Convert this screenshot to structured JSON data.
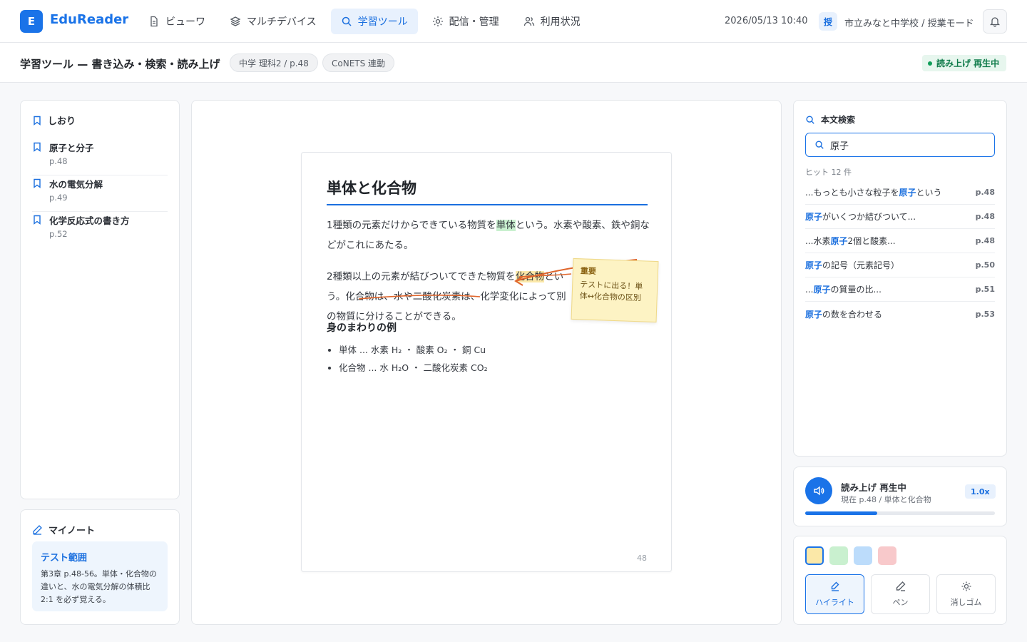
{
  "app": {
    "logo_letter": "E",
    "name": "EduReader"
  },
  "nav": [
    {
      "label": "ビューワ",
      "icon": "document-icon"
    },
    {
      "label": "マルチデバイス",
      "icon": "layers-icon"
    },
    {
      "label": "学習ツール",
      "icon": "search-icon",
      "active": true
    },
    {
      "label": "配信・管理",
      "icon": "gear-icon"
    },
    {
      "label": "利用状況",
      "icon": "users-icon"
    }
  ],
  "header": {
    "datetime": "2026/05/13 10:40",
    "school_badge": "授",
    "school_text": "市立みなと中学校 / 授業モード"
  },
  "subheader": {
    "title": "学習ツール — 書き込み・検索・読み上げ",
    "chips": [
      "中学 理科2 / p.48",
      "CoNETS 連動"
    ],
    "status": "読み上げ 再生中"
  },
  "bookmarks": {
    "heading": "しおり",
    "items": [
      {
        "title": "原子と分子",
        "page": "p.48"
      },
      {
        "title": "水の電気分解",
        "page": "p.49"
      },
      {
        "title": "化学反応式の書き方",
        "page": "p.52"
      }
    ]
  },
  "notes": {
    "heading": "マイノート",
    "card_title": "テスト範囲",
    "card_body": "第3章 p.48-56。単体・化合物の違いと、水の電気分解の体積比 2:1 を必ず覚える。"
  },
  "document": {
    "title": "単体と化合物",
    "p1_a": "1種類の元素だけからできている物質を",
    "p1_hl": "単体",
    "p1_b": "という。水素や酸素、鉄や銅などがこれにあたる。",
    "p2_a": "2種類以上の元素が結びついてできた物質を",
    "p2_hl": "化合物",
    "p2_b": "という。化合物は、水や二酸化炭素は、化学変化によって別の物質に分けることができる。",
    "section": "身のまわりの例",
    "list": [
      "単体 ... 水素 H₂ ・ 酸素 O₂ ・ 銅 Cu",
      "化合物 ... 水 H₂O ・ 二酸化炭素 CO₂"
    ],
    "page_number": "48",
    "sticky_title": "重要",
    "sticky_body": "テストに出る！単体↔化合物の区別"
  },
  "search": {
    "heading": "本文検索",
    "query": "原子",
    "hits": "ヒット 12 件",
    "results": [
      {
        "pre": "...もっとも小さな粒子を",
        "match": "原子",
        "post": "という",
        "page": "p.48"
      },
      {
        "pre": "",
        "match": "原子",
        "post": "がいくつか結びついて...",
        "page": "p.48"
      },
      {
        "pre": "...水素",
        "match": "原子",
        "post": "2個と酸素...",
        "page": "p.48"
      },
      {
        "pre": "",
        "match": "原子",
        "post": "の記号（元素記号）",
        "page": "p.50"
      },
      {
        "pre": "...",
        "match": "原子",
        "post": "の質量の比...",
        "page": "p.51"
      },
      {
        "pre": "",
        "match": "原子",
        "post": "の数を合わせる",
        "page": "p.53"
      }
    ]
  },
  "reader": {
    "title": "読み上げ 再生中",
    "sub": "現在 p.48 / 単体と化合物",
    "speed": "1.0x",
    "progress": 0.38
  },
  "tools": {
    "swatches": [
      "#fbe8a8",
      "#c9f0cf",
      "#bcdcfb",
      "#f8c9cb"
    ],
    "selected_swatch": 0,
    "buttons": [
      {
        "label": "ハイライト",
        "icon": "highlighter-icon",
        "active": true
      },
      {
        "label": "ペン",
        "icon": "pen-icon"
      },
      {
        "label": "消しゴム",
        "icon": "eraser-icon"
      }
    ]
  }
}
